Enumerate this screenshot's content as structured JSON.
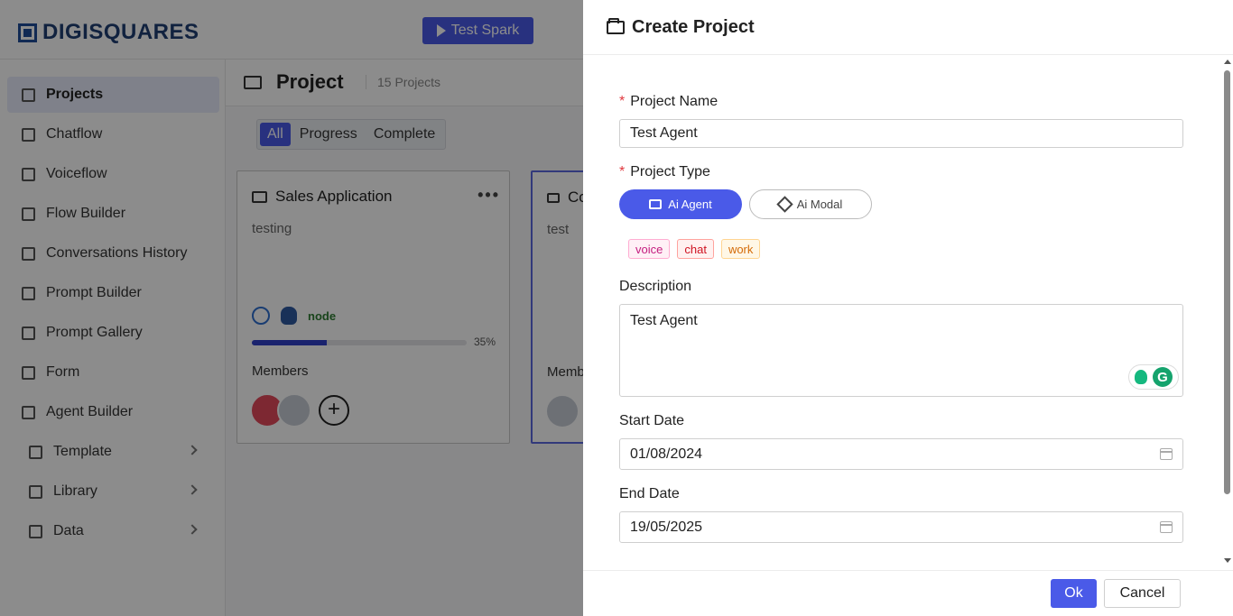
{
  "app": {
    "logo_text": "DIGISQUARES",
    "test_button": "Test Spark"
  },
  "sidebar": {
    "items": [
      {
        "label": "Projects",
        "icon": "folder-open-icon"
      },
      {
        "label": "Chatflow",
        "icon": "chatflow-icon"
      },
      {
        "label": "Voiceflow",
        "icon": "microphone-icon"
      },
      {
        "label": "Flow Builder",
        "icon": "flow-builder-icon"
      },
      {
        "label": "Conversations History",
        "icon": "conversation-history-icon"
      },
      {
        "label": "Prompt Builder",
        "icon": "prompt-builder-icon"
      },
      {
        "label": "Prompt Gallery",
        "icon": "prompt-gallery-icon"
      },
      {
        "label": "Form",
        "icon": "form-icon"
      },
      {
        "label": "Agent Builder",
        "icon": "agent-builder-icon"
      },
      {
        "label": "Template",
        "icon": "template-icon"
      },
      {
        "label": "Library",
        "icon": "library-icon"
      },
      {
        "label": "Data",
        "icon": "data-icon"
      }
    ]
  },
  "main": {
    "title": "Project",
    "count": "15 Projects",
    "filters": [
      "All",
      "Progress",
      "Complete"
    ],
    "cards": [
      {
        "title": "Sales Application",
        "description": "testing",
        "tech": [
          "react",
          "postgresql",
          "node"
        ],
        "progress_percent": 35,
        "progress_label": "35%",
        "members_label": "Members"
      },
      {
        "title": "Co",
        "description": "test",
        "members_label": "Memb"
      }
    ]
  },
  "drawer": {
    "title": "Create Project",
    "project_name_label": "Project Name",
    "project_name_value": "Test Agent",
    "project_type_label": "Project Type",
    "type_options": [
      "Ai Agent",
      "Ai Modal"
    ],
    "selected_type": "Ai Agent",
    "tags": [
      "voice",
      "chat",
      "work"
    ],
    "description_label": "Description",
    "description_value": "Test Agent",
    "start_date_label": "Start Date",
    "start_date_value": "01/08/2024",
    "end_date_label": "End Date",
    "end_date_value": "19/05/2025",
    "ok_label": "Ok",
    "cancel_label": "Cancel",
    "required_mark": "*"
  },
  "colors": {
    "accent": "#4a5ae8",
    "tag_voice": "#c41d7f",
    "tag_chat": "#cf1322",
    "tag_work": "#d46b08"
  }
}
